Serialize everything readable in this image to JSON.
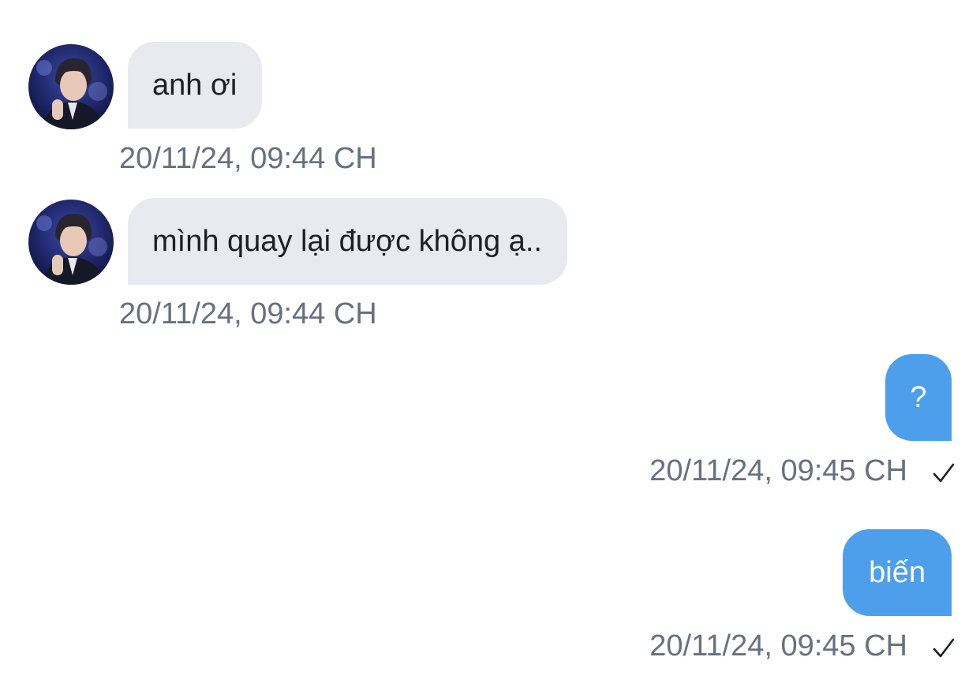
{
  "messages": [
    {
      "direction": "incoming",
      "text": "anh ơi",
      "time": "20/11/24, 09:44 CH",
      "avatar": "user-avatar"
    },
    {
      "direction": "incoming",
      "text": "mình quay lại được không ạ..",
      "time": "20/11/24, 09:44 CH",
      "avatar": "user-avatar"
    },
    {
      "direction": "outgoing",
      "text": "?",
      "time": "20/11/24, 09:45 CH",
      "status_icon": "check-icon"
    },
    {
      "direction": "outgoing",
      "text": "biến",
      "time": "20/11/24, 09:45 CH",
      "status_icon": "check-icon"
    }
  ],
  "colors": {
    "incoming_bubble": "#e7eaee",
    "outgoing_bubble": "#4d9fec",
    "timestamp": "#66717f",
    "incoming_text": "#1c1f23",
    "outgoing_text": "#ffffff"
  }
}
